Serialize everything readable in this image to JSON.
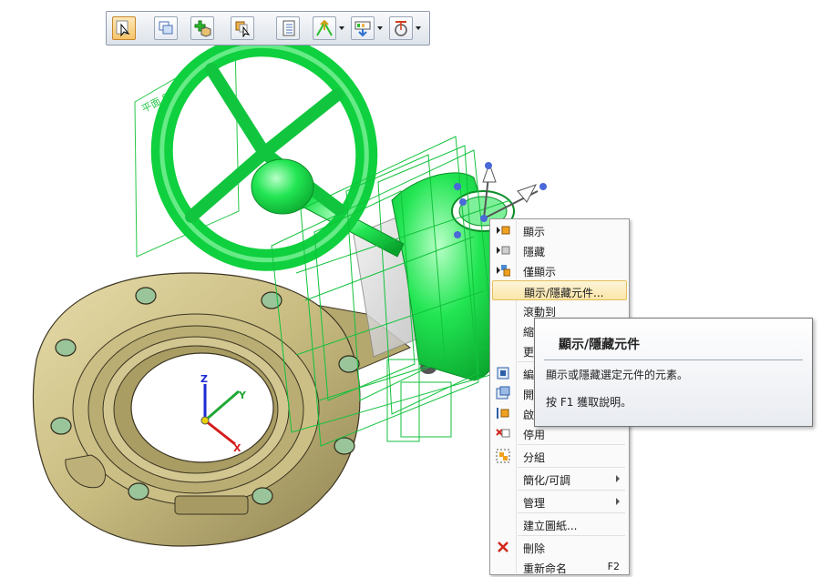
{
  "viewport": {
    "plane_label": "平面 9",
    "triad_axes": {
      "x": "X",
      "y": "Y",
      "z": "Z"
    },
    "colors": {
      "selected_part": "#19e44b",
      "body": "#c9bd83",
      "wireframe": "#12c23c"
    }
  },
  "toolbar": {
    "buttons": [
      {
        "name": "select-tool",
        "icon": "select-arrow-icon",
        "active": true
      },
      {
        "name": "window-tool",
        "icon": "window-icon"
      },
      {
        "name": "add-part-tool",
        "icon": "add-part-icon"
      },
      {
        "name": "edit-part-tool",
        "icon": "edit-part-icon"
      },
      {
        "name": "list-tool",
        "icon": "list-icon"
      },
      {
        "name": "plane-tool",
        "icon": "plane-icon",
        "dropdown": true
      },
      {
        "name": "display-tool",
        "icon": "display-icon",
        "dropdown": true
      },
      {
        "name": "measure-tool",
        "icon": "measure-icon",
        "dropdown": true
      }
    ]
  },
  "context_menu": {
    "items": [
      {
        "label": "顯示",
        "icon": "show-icon"
      },
      {
        "label": "隱藏",
        "icon": "hide-icon"
      },
      {
        "label": "僅顯示",
        "icon": "show-only-icon"
      },
      {
        "label": "顯示/隱藏元件...",
        "highlighted": true
      },
      {
        "label": "滾動到"
      },
      {
        "label": "縮"
      },
      {
        "label": "更"
      },
      {
        "label": "編",
        "icon": "edit-icon"
      },
      {
        "label": "開",
        "icon": "open-icon"
      },
      {
        "label": "啟",
        "icon": "activate-icon"
      },
      {
        "label": "停用",
        "icon": "deactivate-icon"
      },
      {
        "label": "分組",
        "icon": "group-icon"
      },
      {
        "label": "簡化/可調",
        "submenu": true
      },
      {
        "label": "管理",
        "submenu": true
      },
      {
        "label": "建立圖紙..."
      },
      {
        "label": "刪除",
        "icon": "delete-icon"
      },
      {
        "label": "重新命名",
        "shortcut": "F2"
      }
    ]
  },
  "tooltip": {
    "title": "顯示/隱藏元件",
    "description": "顯示或隱藏選定元件的元素。",
    "help": "按 F1 獲取說明。"
  }
}
